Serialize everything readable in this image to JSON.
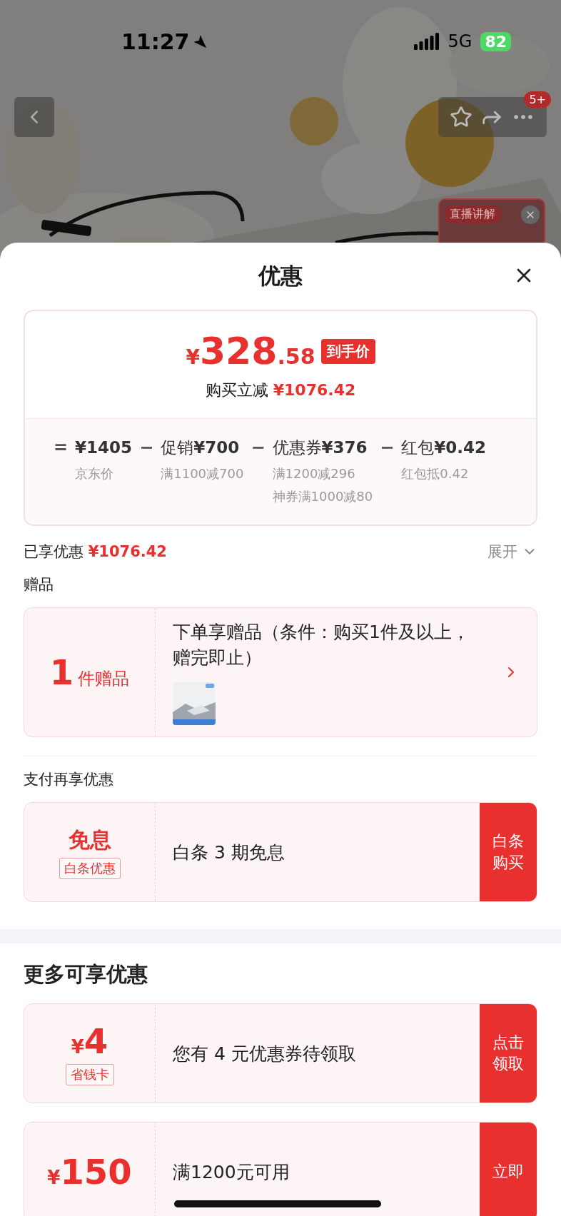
{
  "status_bar": {
    "time": "11:27",
    "network": "5G",
    "battery": "82"
  },
  "product_header": {
    "cart_badge": "5+",
    "live_label": "直播讲解"
  },
  "sheet": {
    "title": "优惠"
  },
  "price_summary": {
    "currency": "¥",
    "price_integer": "328",
    "price_decimal": ".58",
    "tag": "到手价",
    "saving_label": "购买立减",
    "saving_value": "¥1076.42",
    "breakdown": [
      {
        "operator": "=",
        "amount": "¥1405",
        "notes": [
          "京东价"
        ]
      },
      {
        "operator": "−",
        "label": "促销",
        "amount": "¥700",
        "notes": [
          "满1100减700"
        ]
      },
      {
        "operator": "−",
        "label": "优惠券",
        "amount": "¥376",
        "notes": [
          "满1200减296",
          "神券满1000减80"
        ]
      },
      {
        "operator": "−",
        "label": "红包",
        "amount": "¥0.42",
        "notes": [
          "红包抵0.42"
        ]
      }
    ]
  },
  "enjoyed": {
    "label": "已享优惠",
    "amount": "¥1076.42",
    "toggle": "展开",
    "expanded": false
  },
  "gift_section": {
    "heading": "赠品",
    "count": "1",
    "unit": "件赠品",
    "description": "下单享赠品（条件：购买1件及以上，赠完即止）"
  },
  "pay_section": {
    "heading": "支付再享优惠",
    "offers": [
      {
        "kind": "text",
        "title": "免息",
        "tag": "白条优惠",
        "description": "白条 3 期免息",
        "action": "白条购买"
      }
    ]
  },
  "more_section": {
    "heading": "更多可享优惠",
    "offers": [
      {
        "kind": "amount",
        "currency": "¥",
        "amount": "4",
        "tag": "省钱卡",
        "description": "您有 4 元优惠券待领取",
        "action": "点击领取"
      },
      {
        "kind": "amount",
        "currency": "¥",
        "amount": "150",
        "description": "满1200元可用",
        "action": "立即"
      }
    ]
  }
}
